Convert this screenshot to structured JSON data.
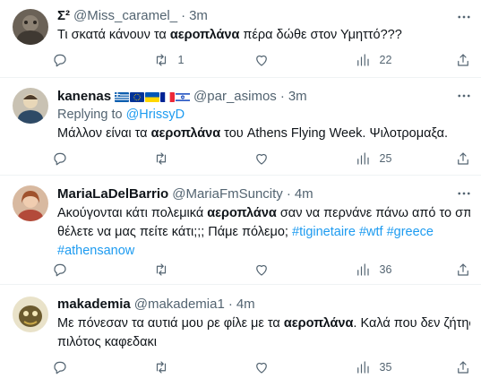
{
  "tweets": [
    {
      "name": "Σ²",
      "handle": "@Miss_caramel_",
      "separator": "·",
      "time": "3m",
      "reply_prefix": "",
      "reply_to": "",
      "line1": [
        "Τι σκατά κάνουν τα ",
        "αεροπλάνα",
        " πέρα δώθε στον Υμηττό???"
      ],
      "line2": [],
      "counts": {
        "replies": "",
        "retweets": "1",
        "likes": "",
        "views": "22"
      }
    },
    {
      "name": "kanenas",
      "handle": "@par_asimos",
      "separator": "·",
      "time": "3m",
      "flags": [
        "greece",
        "european-union",
        "ukraine",
        "france",
        "israel"
      ],
      "reply_prefix": "Replying to ",
      "reply_to": "@HrissyD",
      "line1": [
        "Μάλλον είναι τα ",
        "αεροπλάνα",
        " του Athens Flying Week. Ψιλοτρομαξα."
      ],
      "line2": [],
      "counts": {
        "replies": "",
        "retweets": "",
        "likes": "",
        "views": "25"
      }
    },
    {
      "name": "MariaLaDelBarrio",
      "handle": "@MariaFmSuncity",
      "separator": "·",
      "time": "4m",
      "reply_prefix": "",
      "reply_to": "",
      "line1": [
        "Ακούγονται κάτι πολεμικά ",
        "αεροπλάνα",
        " σαν να περνάνε πάνω από το σπίτι..."
      ],
      "line2_text": "θέλετε να μας πείτε κάτι;;; Πάμε πόλεμο; ",
      "hashtags_line2": [
        "#tiginetaire",
        "#wtf",
        "#greece"
      ],
      "line3_hashtag": "#athensanow",
      "counts": {
        "replies": "",
        "retweets": "",
        "likes": "",
        "views": "36"
      }
    },
    {
      "name": "makademia",
      "handle": "@makademia1",
      "separator": "·",
      "time": "4m",
      "reply_prefix": "",
      "reply_to": "",
      "line1": [
        "Με πόνεσαν τα αυτιά μου ρε φίλε με τα ",
        "αεροπλάνα",
        ". Καλά που δεν ζήτησε ο"
      ],
      "line2_text": "πιλότος καφεδακι",
      "counts": {
        "replies": "",
        "retweets": "",
        "likes": "",
        "views": "35"
      }
    }
  ],
  "icons": {
    "reply": "speech-bubble-icon",
    "retweet": "retweet-arrows-icon",
    "like": "heart-icon",
    "views": "bar-chart-icon",
    "share": "share-upload-icon",
    "more": "more-dots-icon"
  },
  "colors": {
    "text": "#0f1419",
    "muted": "#536471",
    "link": "#1d9bf0",
    "divider": "#eff3f4"
  }
}
